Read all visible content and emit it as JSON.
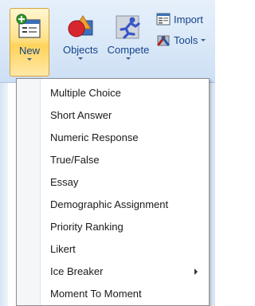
{
  "ribbon": {
    "buttons": [
      {
        "label": "New",
        "icon": "new-slide-icon"
      },
      {
        "label": "Objects",
        "icon": "objects-icon"
      },
      {
        "label": "Compete",
        "icon": "compete-runner-icon"
      }
    ],
    "small_buttons": [
      {
        "label": "Import",
        "icon": "import-icon"
      },
      {
        "label": "Tools",
        "icon": "tools-icon"
      }
    ]
  },
  "menu": {
    "items": [
      {
        "label": "Multiple Choice"
      },
      {
        "label": "Short Answer"
      },
      {
        "label": "Numeric Response"
      },
      {
        "label": "True/False"
      },
      {
        "label": "Essay"
      },
      {
        "label": "Demographic Assignment"
      },
      {
        "label": "Priority Ranking"
      },
      {
        "label": "Likert"
      },
      {
        "label": "Ice Breaker",
        "has_submenu": true
      },
      {
        "label": "Moment To Moment"
      }
    ]
  },
  "colors": {
    "ribbon_text": "#15428b",
    "active_button": "#ffd35a",
    "menu_border": "#8c8c8c"
  }
}
